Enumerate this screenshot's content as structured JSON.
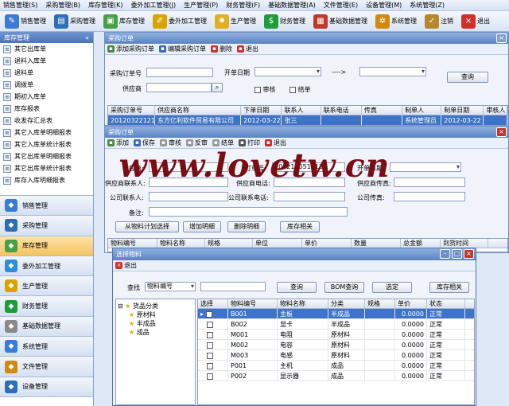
{
  "menu": [
    "销售管理(S)",
    "采购管理(B)",
    "库存管理(K)",
    "委外加工管理(J)",
    "生产管理(P)",
    "财务管理(F)",
    "基础数据管理(A)",
    "文件管理(E)",
    "设备管理(M)",
    "系统管理(Z)"
  ],
  "toolbar": [
    {
      "label": "销售管理",
      "icon": "pen-icon",
      "color": "#3a7bd5"
    },
    {
      "label": "采购管理",
      "icon": "truck-icon",
      "color": "#2d6fb7"
    },
    {
      "label": "库存管理",
      "icon": "box-icon",
      "color": "#46a046"
    },
    {
      "label": "委外加工管理",
      "icon": "pencil-icon",
      "color": "#d9a400"
    },
    {
      "label": "生产管理",
      "icon": "gear-icon",
      "color": "#e0b020"
    },
    {
      "label": "财务管理",
      "icon": "dollar-icon",
      "color": "#1f9d3a"
    },
    {
      "label": "基础数据管理",
      "icon": "calendar-icon",
      "color": "#c0392b"
    },
    {
      "label": "系统管理",
      "icon": "system-gear-icon",
      "color": "#d08a10"
    },
    {
      "label": "注销",
      "icon": "logoff-icon",
      "color": "#b7872a"
    },
    {
      "label": "退出",
      "icon": "close-icon",
      "color": "#d0302a"
    }
  ],
  "sidebar": {
    "title": "库存管理",
    "collapse": "«",
    "items": [
      "其它出库单",
      "退料入库单",
      "退料单",
      "调拨单",
      "期初入库单",
      "库存报表",
      "收发存汇总表",
      "其它入库单明细报表",
      "其它入库单统计报表",
      "其它出库单明细报表",
      "其它出库单统计报表",
      "库存入库明细报表"
    ],
    "modules": [
      "销售管理",
      "采购管理",
      "库存管理",
      "委外加工管理",
      "生产管理",
      "财务管理",
      "基础数据管理",
      "系统管理",
      "文件管理",
      "设备管理"
    ],
    "active_module": "库存管理"
  },
  "po_window": {
    "title": "采购订单",
    "actions": [
      "添加采购订单",
      "编辑采购订单",
      "删除",
      "退出"
    ],
    "labels": {
      "po_no": "采购订单号",
      "open_date": "开单日期",
      "arrow": "---->",
      "supplier": "供应商",
      "audit": "审核",
      "close": "结单",
      "query": "查询"
    },
    "columns": [
      "采购订单号",
      "供应商名称",
      "下单日期",
      "联系人",
      "联系电话",
      "传真",
      "制单人",
      "制单日期",
      "审核人"
    ],
    "row": [
      "201203221212",
      "东方亿利软件贸易有限公司",
      "2012-03-22",
      "张三",
      "",
      "",
      "系统管理员",
      "2012-03-22",
      ""
    ]
  },
  "po_edit": {
    "title": "采购订单",
    "actions": [
      "添加",
      "保存",
      "审核",
      "反审",
      "结单",
      "打印",
      "退出"
    ],
    "labels": {
      "supplier": "供应商:",
      "order_no": "订单号:",
      "open_date": "开单日期:",
      "supplier_contact": "供应商联系人:",
      "supplier_phone": "供应商电话:",
      "supplier_fax": "供应商传真:",
      "company_contact": "公司联系人:",
      "company_phone": "公司联系电话:",
      "company_fax": "公司传真:",
      "remark": "备注:"
    },
    "order_no": "201210051213",
    "buttons": [
      "从物料计划选择",
      "增加明细",
      "删除明细",
      "库存相关"
    ],
    "columns": [
      "物料编号",
      "物料名称",
      "规格",
      "单位",
      "单价",
      "数量",
      "总金额",
      "到货时间"
    ]
  },
  "select_dialog": {
    "title": "选择物料",
    "exit": "退出",
    "find_label": "查找",
    "find_field": "物料编号",
    "buttons": [
      "查询",
      "BOM查询",
      "选定",
      "库存相关"
    ],
    "tree_root": "货品分类",
    "tree_children": [
      "原材料",
      "半成品",
      "成品"
    ],
    "columns": [
      "选择",
      "物料编号",
      "物料名称",
      "分类",
      "规格",
      "单价",
      "状态"
    ],
    "rows": [
      [
        "B001",
        "主板",
        "半成品",
        "",
        "0.0000",
        "正常"
      ],
      [
        "B002",
        "显卡",
        "半成品",
        "",
        "0.0000",
        "正常"
      ],
      [
        "M001",
        "电阻",
        "原材料",
        "",
        "0.0000",
        "正常"
      ],
      [
        "M002",
        "电容",
        "原材料",
        "",
        "0.0000",
        "正常"
      ],
      [
        "M003",
        "电感",
        "原材料",
        "",
        "0.0000",
        "正常"
      ],
      [
        "P001",
        "主机",
        "成品",
        "",
        "0.0000",
        "正常"
      ],
      [
        "P002",
        "显示器",
        "成品",
        "",
        "0.0000",
        "正常"
      ]
    ]
  },
  "watermark": "www.lovetw.cn"
}
